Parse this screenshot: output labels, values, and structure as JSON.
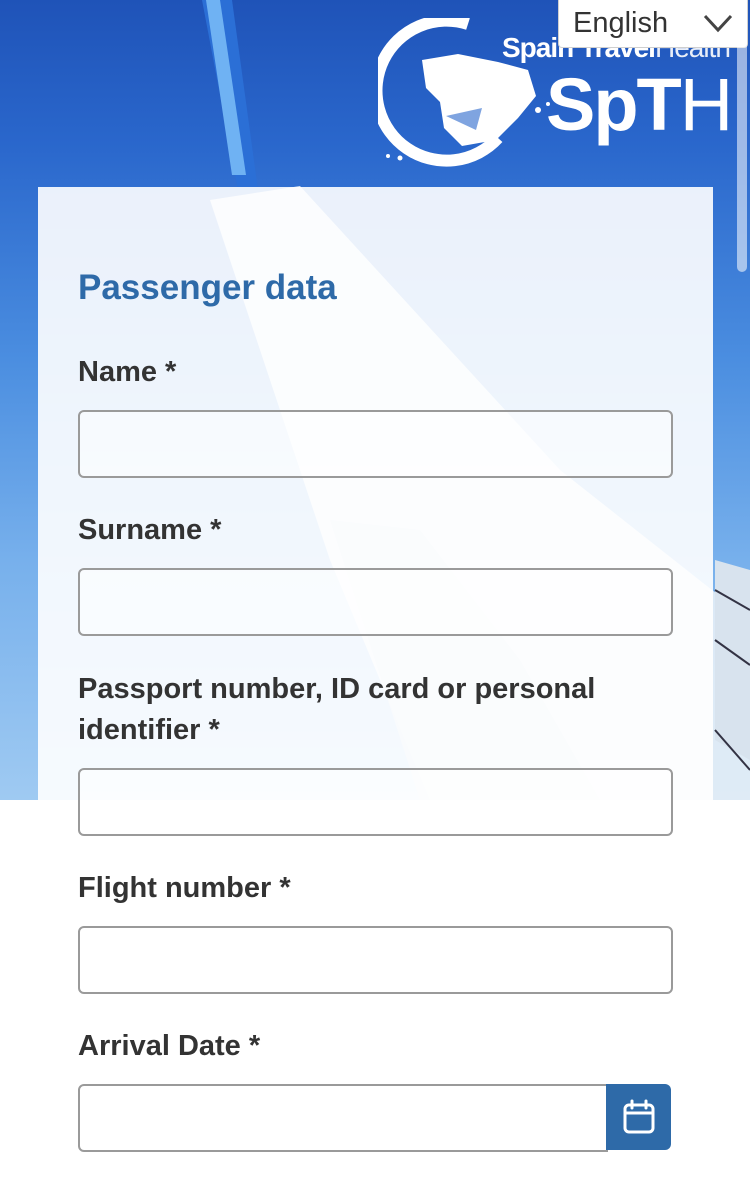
{
  "language": {
    "selected": "English"
  },
  "logo": {
    "tagline_bold": "Spain Travel",
    "tagline_light": "Health",
    "abbr_bold": "SpT",
    "abbr_light": "H"
  },
  "form": {
    "title": "Passenger data",
    "fields": {
      "name": {
        "label": "Name *",
        "value": ""
      },
      "surname": {
        "label": "Surname *",
        "value": ""
      },
      "passport": {
        "label": "Passport number, ID card or personal identifier *",
        "value": ""
      },
      "flight": {
        "label": "Flight number *",
        "value": ""
      },
      "arrival_date": {
        "label": "Arrival Date *",
        "value": ""
      }
    }
  },
  "icons": {
    "language_chevron": "chevron-down-icon",
    "calendar": "calendar-icon",
    "logo_map": "spain-map-icon"
  },
  "colors": {
    "accent": "#2e6aa8",
    "sky": "#2a67cc"
  }
}
